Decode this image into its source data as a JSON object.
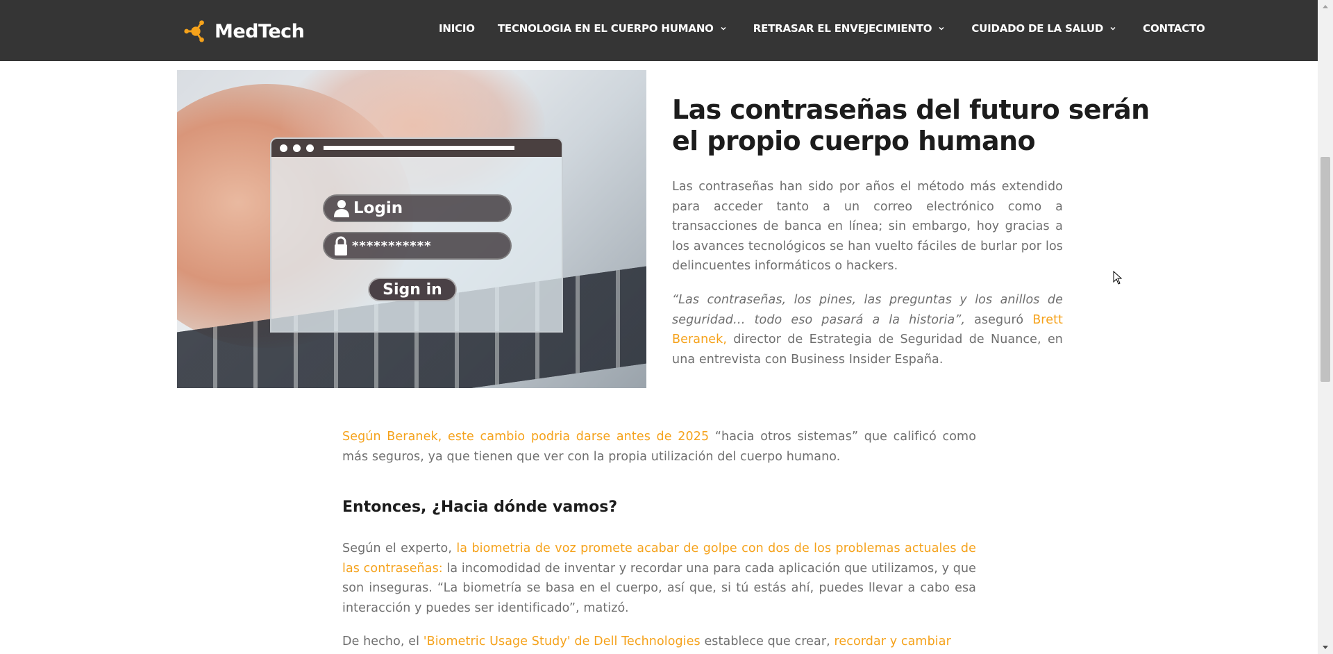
{
  "site": {
    "logo_text": "MedTech",
    "brand_color": "#f5a21b",
    "header_bg": "#353535"
  },
  "nav": {
    "items": [
      {
        "label": "INICIO",
        "has_dropdown": false
      },
      {
        "label": "TECNOLOGIA EN EL CUERPO HUMANO",
        "has_dropdown": true
      },
      {
        "label": "RETRASAR EL ENVEJECIMIENTO",
        "has_dropdown": true
      },
      {
        "label": "CUIDADO DE LA SALUD",
        "has_dropdown": true
      },
      {
        "label": "CONTACTO",
        "has_dropdown": false
      }
    ]
  },
  "hero_image": {
    "login_label": "Login",
    "password_mask": "***********",
    "signin_label": "Sign in"
  },
  "article": {
    "title": "Las contraseñas del futuro serán el propio cuerpo humano",
    "p1": "Las contraseñas han sido por años el método más extendido para acceder tanto a un correo electrónico como a transacciones de banca en línea; sin embargo, hoy gracias a los avances tecnológicos se han vuelto fáciles de burlar por los delincuentes informáticos o hackers.",
    "p2_quote": "“Las contraseñas, los pines, las preguntas y los anillos de seguridad… todo eso pasará a la historia”,",
    "p2_mid": " aseguró ",
    "p2_link": "Brett Beranek,",
    "p2_tail": " director de Estrategia de Seguridad de Nuance, en una entrevista con Business Insider España.",
    "p3_link": "Según Beranek, este cambio podria darse antes de 2025",
    "p3_tail": " “hacia otros sistemas” que calificó como más seguros, ya que tienen que ver con la propia utilización del cuerpo humano.",
    "h2": "Entonces, ¿Hacia dónde vamos?",
    "p4_head": "Según el experto, ",
    "p4_link": "la biometria de voz promete acabar de golpe con dos de los problemas actuales de las contraseñas:",
    "p4_tail": " la incomodidad de inventar y recordar una para cada aplicación que utilizamos, y que son inseguras. “La biometría se basa en el cuerpo, así que, si tú estás ahí, puedes llevar a cabo esa interacción y puedes ser identificado”, matizó.",
    "p5_head": "De hecho, el ",
    "p5_link1": "'Biometric Usage Study' de Dell Technologies",
    "p5_mid": " establece que crear, ",
    "p5_link2": "recordar y cambiar"
  }
}
